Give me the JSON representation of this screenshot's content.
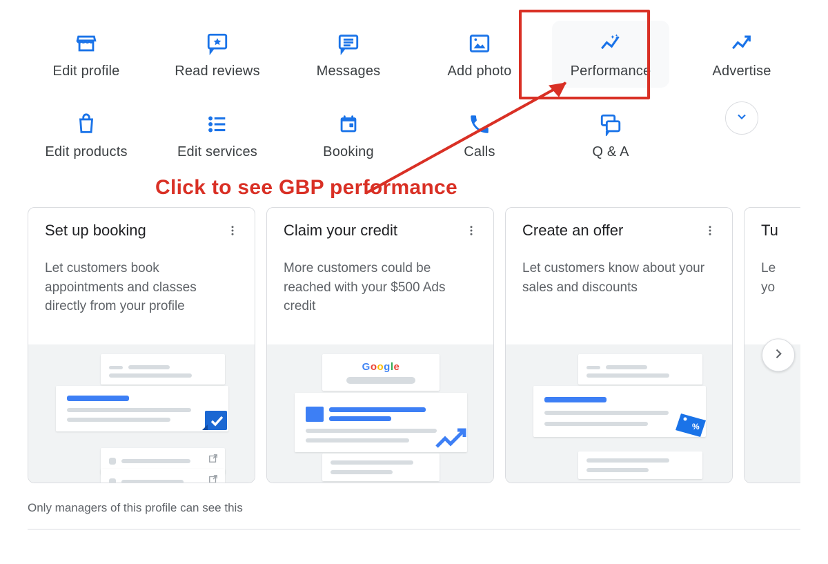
{
  "nav": {
    "items": [
      {
        "label": "Edit profile",
        "icon": "storefront-icon"
      },
      {
        "label": "Read reviews",
        "icon": "review-star-icon"
      },
      {
        "label": "Messages",
        "icon": "messages-icon"
      },
      {
        "label": "Add photo",
        "icon": "add-photo-icon"
      },
      {
        "label": "Performance",
        "icon": "performance-icon",
        "highlighted": true
      },
      {
        "label": "Advertise",
        "icon": "advertise-icon"
      },
      {
        "label": "Edit products",
        "icon": "products-icon"
      },
      {
        "label": "Edit services",
        "icon": "services-icon"
      },
      {
        "label": "Booking",
        "icon": "booking-icon"
      },
      {
        "label": "Calls",
        "icon": "calls-icon"
      },
      {
        "label": "Q & A",
        "icon": "qa-icon"
      }
    ]
  },
  "annotation": {
    "text": "Click to see GBP performance"
  },
  "cards": [
    {
      "title": "Set up booking",
      "body": "Let customers book appointments and classes directly from your profile"
    },
    {
      "title": "Claim your credit",
      "body": "More customers could be reached with your $500 Ads credit"
    },
    {
      "title": "Create an offer",
      "body": "Let customers know about your sales and discounts"
    },
    {
      "title": "Tu",
      "body": "Le\nyo"
    }
  ],
  "footer": "Only managers of this profile can see this",
  "colors": {
    "blue": "#1a73e8",
    "annotation_red": "#d93025"
  }
}
